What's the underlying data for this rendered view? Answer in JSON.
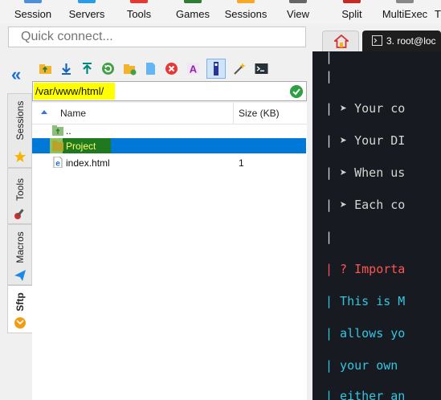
{
  "menu": {
    "items": [
      {
        "label": "Session",
        "icon_color": "#4e8fd6"
      },
      {
        "label": "Servers",
        "icon_color": "#2b9de6"
      },
      {
        "label": "Tools",
        "icon_color": "#e53935"
      },
      {
        "label": "Games",
        "icon_color": "#2e7d32"
      },
      {
        "label": "Sessions",
        "icon_color": "#f9a825"
      },
      {
        "label": "View",
        "icon_color": "#666666"
      },
      {
        "label": "Split",
        "icon_color": "#c62828"
      },
      {
        "label": "MultiExec",
        "icon_color": "#888888"
      },
      {
        "label": "T",
        "icon_color": "#888888"
      }
    ]
  },
  "quick_connect": {
    "placeholder": "Quick connect..."
  },
  "sidebar": {
    "tabs": [
      {
        "label": "Sessions",
        "icon": "star-icon"
      },
      {
        "label": "Tools",
        "icon": "wrench-icon"
      },
      {
        "label": "Macros",
        "icon": "send-icon"
      },
      {
        "label": "Sftp",
        "icon": "sftp-globe-icon"
      }
    ]
  },
  "sftp": {
    "toolbar": [
      "folder-up-icon",
      "download-icon",
      "upload-icon",
      "refresh-icon",
      "new-folder-icon",
      "new-file-icon",
      "delete-icon",
      "rename-icon",
      "permissions-icon",
      "wand-icon",
      "terminal-icon"
    ],
    "path": "/var/www/html/",
    "columns": {
      "name": "Name",
      "size": "Size (KB)"
    },
    "rows": [
      {
        "name": "..",
        "size": "",
        "type": "parent"
      },
      {
        "name": "Project",
        "size": "",
        "type": "folder",
        "selected": true
      },
      {
        "name": "index.html",
        "size": "1",
        "type": "html"
      }
    ]
  },
  "tabs": {
    "home": "home-icon",
    "session": "3. root@loc"
  },
  "terminal": {
    "lines": [
      {
        "text": "|",
        "class": ""
      },
      {
        "text": "|",
        "class": ""
      },
      {
        "text": "| ➤ Your co",
        "class": ""
      },
      {
        "text": "| ➤ Your DI",
        "class": ""
      },
      {
        "text": "| ➤ When us",
        "class": ""
      },
      {
        "text": "| ➤ Each co",
        "class": ""
      },
      {
        "text": "|",
        "class": ""
      },
      {
        "text": "| ? Importa",
        "class": "red"
      },
      {
        "text": "| This is M",
        "class": "cyan"
      },
      {
        "text": "| allows yo",
        "class": "cyan"
      },
      {
        "text": "| your own ",
        "class": "cyan"
      },
      {
        "text": "| either an",
        "class": "cyan"
      }
    ]
  },
  "colors": {
    "selection": "#0078d7",
    "highlight": "#ffff00",
    "terminal_bg": "#171a21"
  }
}
